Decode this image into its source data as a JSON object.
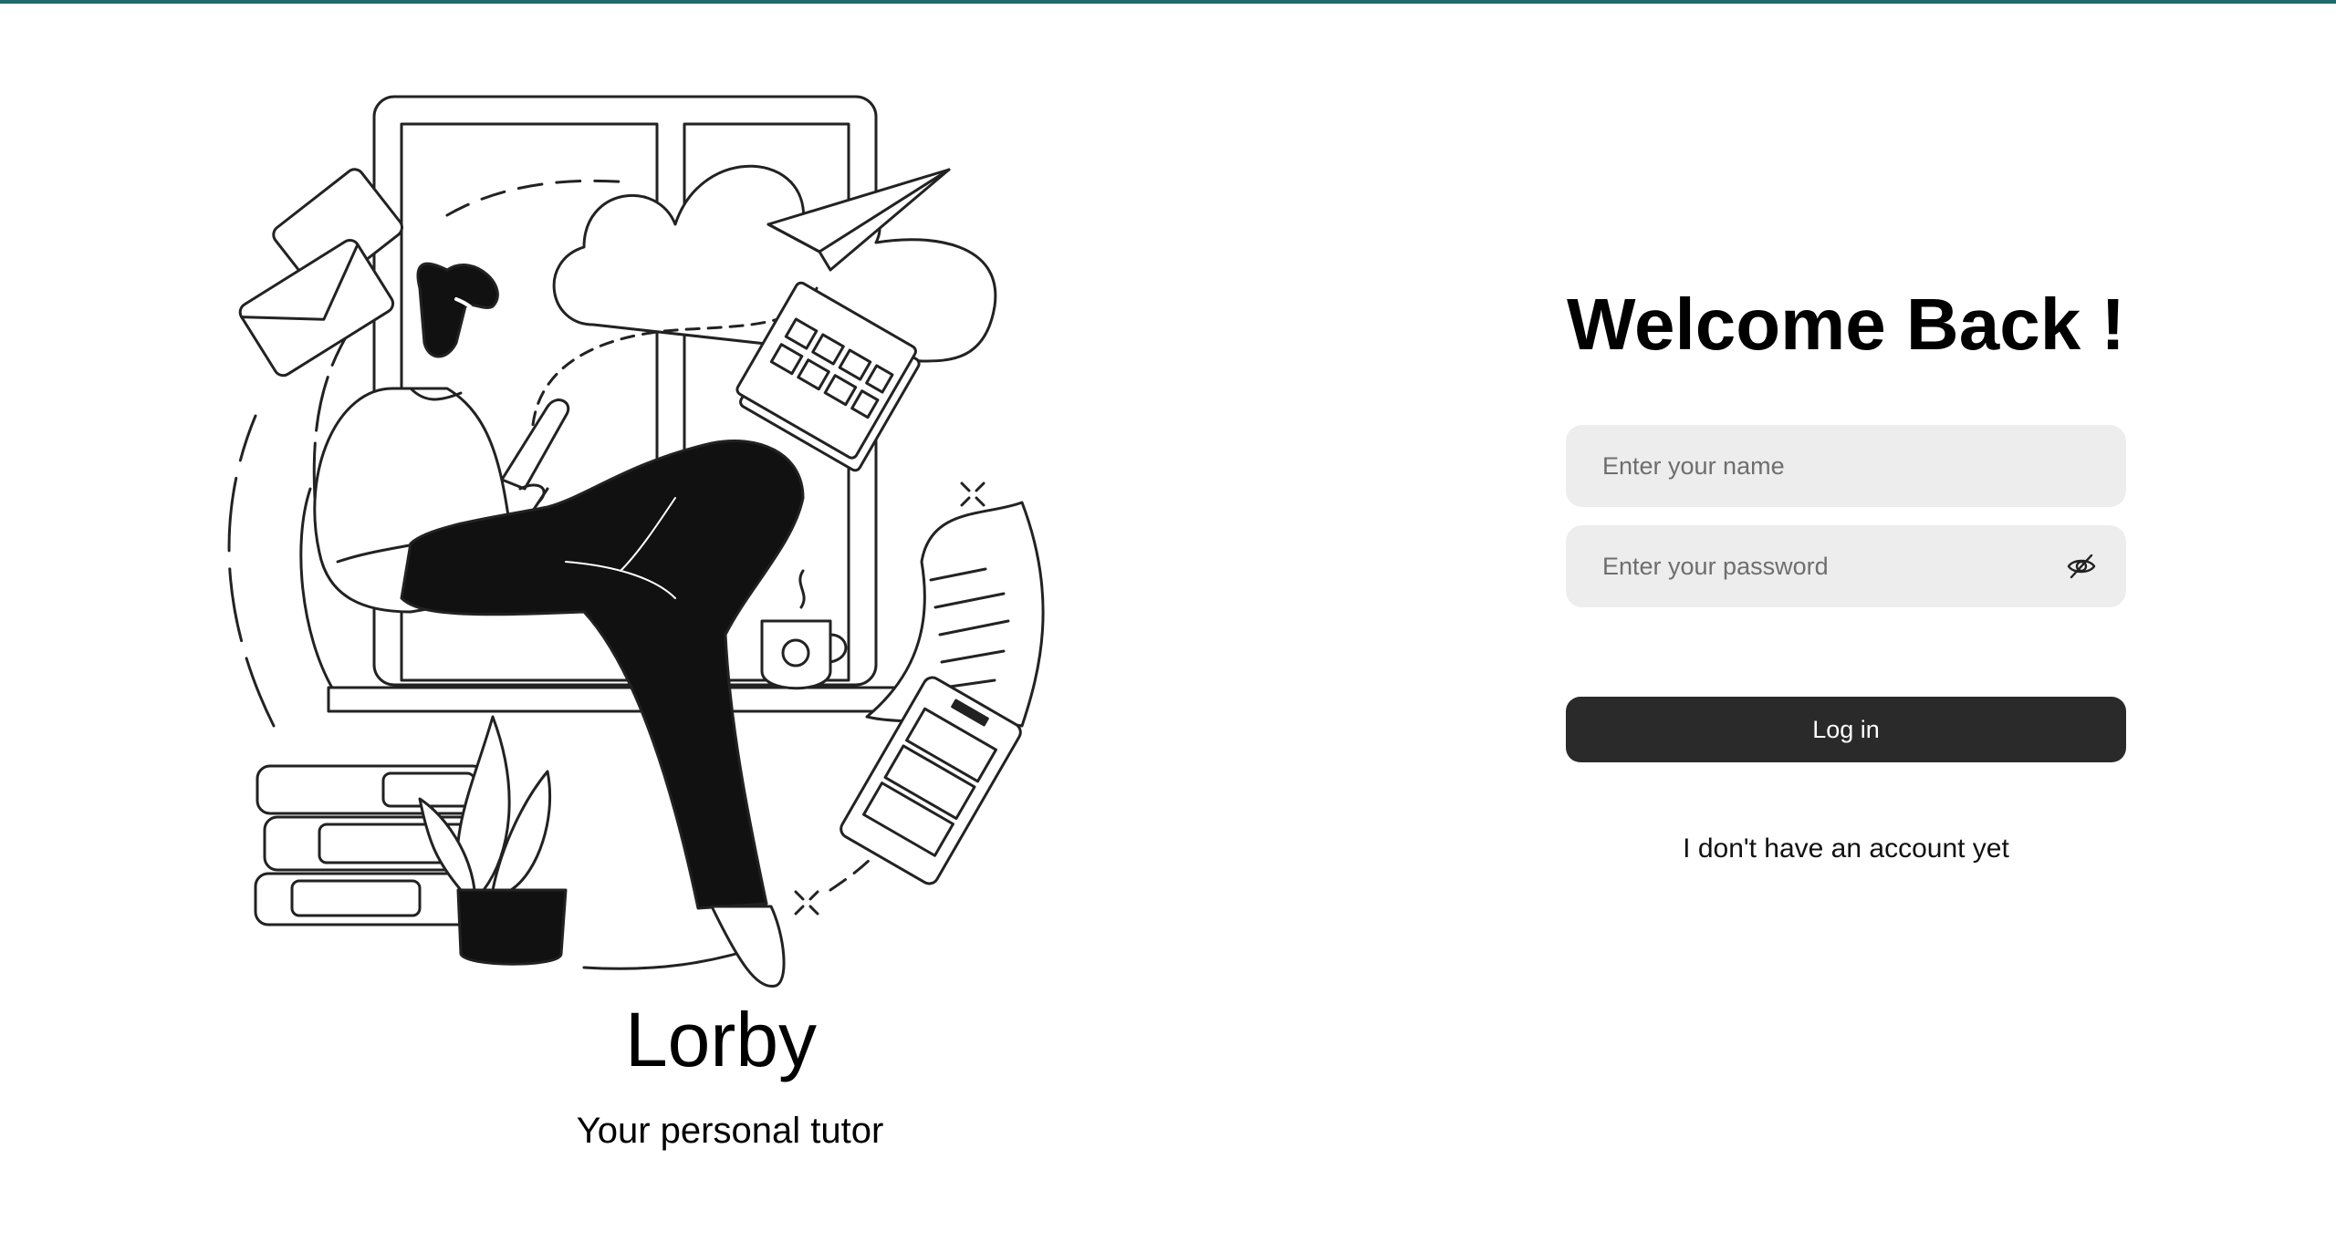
{
  "brand": {
    "name": "Lorby",
    "tagline": "Your personal tutor"
  },
  "login": {
    "title": "Welcome Back !",
    "name_placeholder": "Enter your name",
    "password_placeholder": "Enter your password",
    "login_label": "Log in",
    "signup_link": "I don't have an account yet"
  },
  "colors": {
    "top_bar": "#1d6b6b",
    "input_background": "#ededed",
    "button_background": "#2a2a2a",
    "button_text": "#ffffff"
  },
  "icons": {
    "password_toggle": "eye-off-icon",
    "illustration": "man-on-windowsill-illustration"
  }
}
